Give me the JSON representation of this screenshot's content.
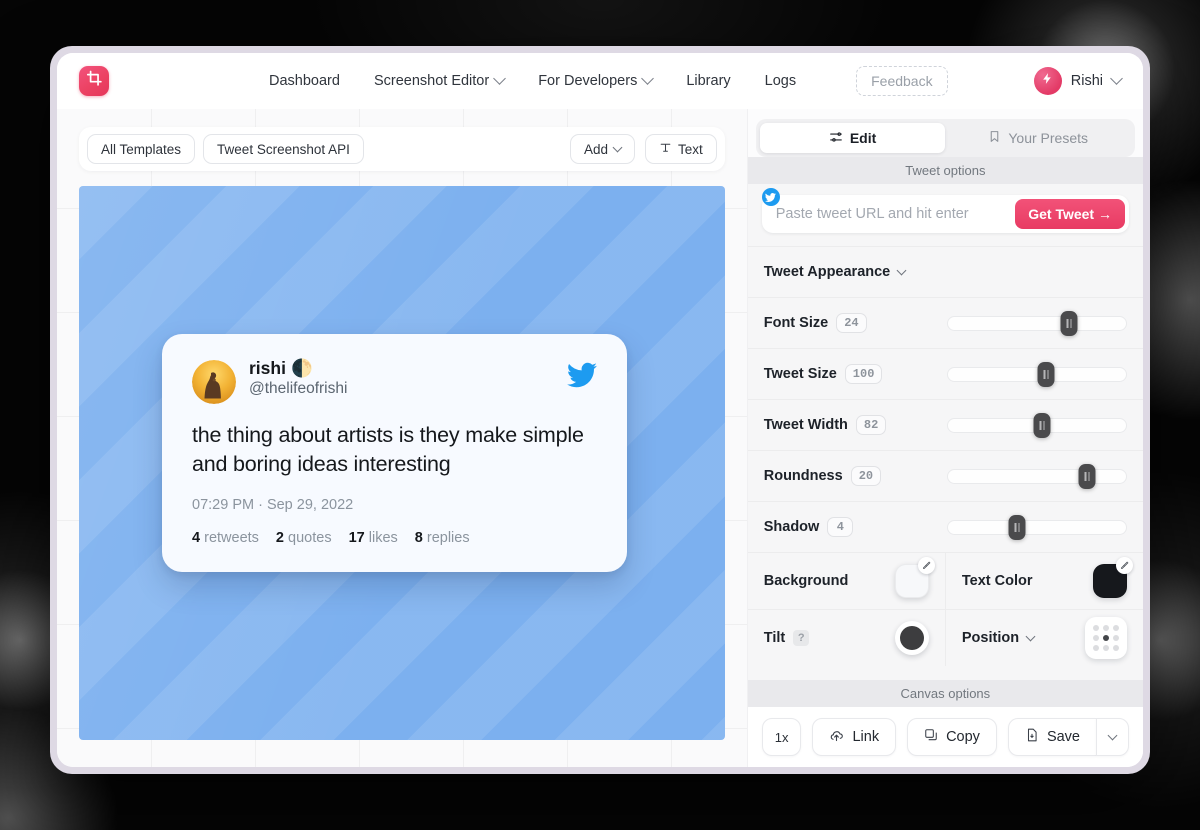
{
  "app": {
    "logo_icon": "crop-tool-icon"
  },
  "topnav": {
    "links": [
      {
        "label": "Dashboard",
        "caret": false
      },
      {
        "label": "Screenshot Editor",
        "caret": true
      },
      {
        "label": "For Developers",
        "caret": true
      },
      {
        "label": "Library",
        "caret": false
      },
      {
        "label": "Logs",
        "caret": false
      }
    ],
    "feedback_label": "Feedback",
    "user_name": "Rishi",
    "user_avatar_icon": "lightning-bolt-icon"
  },
  "toolbar": {
    "all_templates_label": "All Templates",
    "tweet_api_label": "Tweet Screenshot API",
    "add_label": "Add",
    "text_label": "Text",
    "text_icon": "text-tool-icon"
  },
  "canvas": {
    "background_color": "#7cb0ef",
    "pattern": "diagonal-stripes"
  },
  "tweet": {
    "display_name": "rishi",
    "name_emoji": "🌓",
    "handle": "@thelifeofrishi",
    "text": "the thing about artists is they make simple and boring ideas interesting",
    "timestamp": "07:29 PM · Sep 29, 2022",
    "stats": [
      {
        "count": "4",
        "label": "retweets"
      },
      {
        "count": "2",
        "label": "quotes"
      },
      {
        "count": "17",
        "label": "likes"
      },
      {
        "count": "8",
        "label": "replies"
      }
    ],
    "bird_icon": "twitter-bird-icon",
    "avatar_icon": "user-photo-avatar"
  },
  "panel": {
    "tabs": [
      {
        "label": "Edit",
        "icon": "sliders-icon",
        "active": true
      },
      {
        "label": "Your Presets",
        "icon": "bookmark-icon",
        "active": false
      }
    ],
    "tweet_options_header": "Tweet options",
    "canvas_options_header": "Canvas options",
    "url_field": {
      "placeholder": "Paste tweet URL and hit enter",
      "value": "",
      "button_label": "Get Tweet →",
      "badge_icon": "twitter-bird-icon"
    },
    "appearance_label": "Tweet Appearance",
    "sliders": [
      {
        "label": "Font Size",
        "value": "24",
        "percent": 68
      },
      {
        "label": "Tweet Size",
        "value": "100",
        "percent": 55
      },
      {
        "label": "Tweet Width",
        "value": "82",
        "percent": 53
      },
      {
        "label": "Roundness",
        "value": "20",
        "percent": 78
      },
      {
        "label": "Shadow",
        "value": "4",
        "percent": 39
      }
    ],
    "background": {
      "label": "Background",
      "color": "#f7f8fa",
      "eyedropper_icon": "eyedropper-icon"
    },
    "text_color": {
      "label": "Text Color",
      "color": "#16181c",
      "eyedropper_icon": "eyedropper-icon"
    },
    "tilt": {
      "label": "Tilt",
      "help_icon": "question-mark-icon",
      "knob_color": "#3d3d3f"
    },
    "position": {
      "label": "Position",
      "selected_cell": 4
    },
    "footer_buttons": [
      {
        "label": "1x",
        "icon": ""
      },
      {
        "label": "Link",
        "icon": "link-upload-icon"
      },
      {
        "label": "Copy",
        "icon": "copy-icon"
      },
      {
        "label": "Save",
        "icon": "save-file-icon"
      }
    ],
    "save_caret_icon": "chevron-down-icon"
  },
  "colors": {
    "accent_pink": "#e83b63",
    "twitter_blue": "#1d9bf0",
    "canvas_blue": "#7cb0ef"
  }
}
